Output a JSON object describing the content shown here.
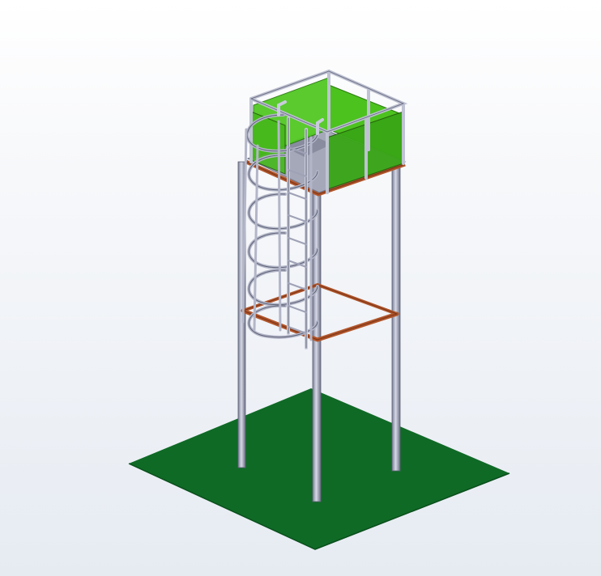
{
  "scene": {
    "subject": "tower",
    "colors": {
      "background_top": "#ffffff",
      "background_bottom": "#e6ebf2",
      "ground": "#0f6a26",
      "steel_light": "#c9ccdc",
      "steel_dark": "#6f7388",
      "rust": "#b1552a",
      "panel_green": "#4cc21e",
      "panel_green_dark": "#39a616",
      "deck": "#a5a8b8"
    }
  }
}
